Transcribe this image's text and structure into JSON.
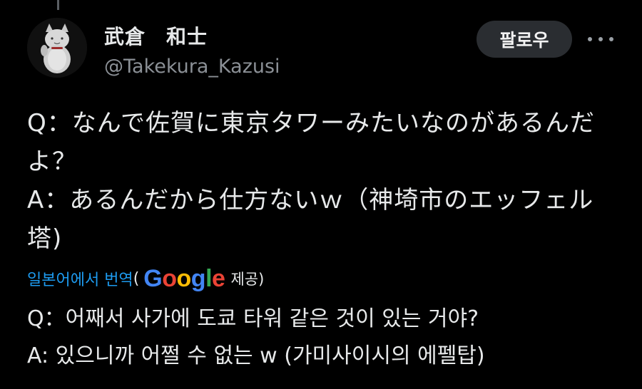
{
  "profile": {
    "display_name": "武倉　和士",
    "handle": "@Takekura_Kazusi",
    "avatar_icon": "maneki-neko-avatar"
  },
  "actions": {
    "follow_label": "팔로우",
    "more_icon": "more-horizontal-icon"
  },
  "tweet": {
    "lines": [
      "Q：なんで佐賀に東京タワーみたいなのがあるんだよ？",
      "A：あるんだから仕方ないｗ（神埼市のエッフェル塔)"
    ]
  },
  "translation": {
    "link_label": "일본어에서 번역",
    "open_paren": "(",
    "google_letters": [
      "G",
      "o",
      "o",
      "g",
      "l",
      "e"
    ],
    "provided_label": "제공)",
    "lines": [
      "Q：어째서 사가에 도쿄 타워 같은 것이 있는 거야?",
      "A: 있으니까 어쩔 수 없는 w (가미사이시의 에펠탑)"
    ]
  },
  "colors": {
    "background": "#000000",
    "link": "#1d9bf0",
    "text": "#e7e9ea",
    "muted": "#8b9096"
  }
}
